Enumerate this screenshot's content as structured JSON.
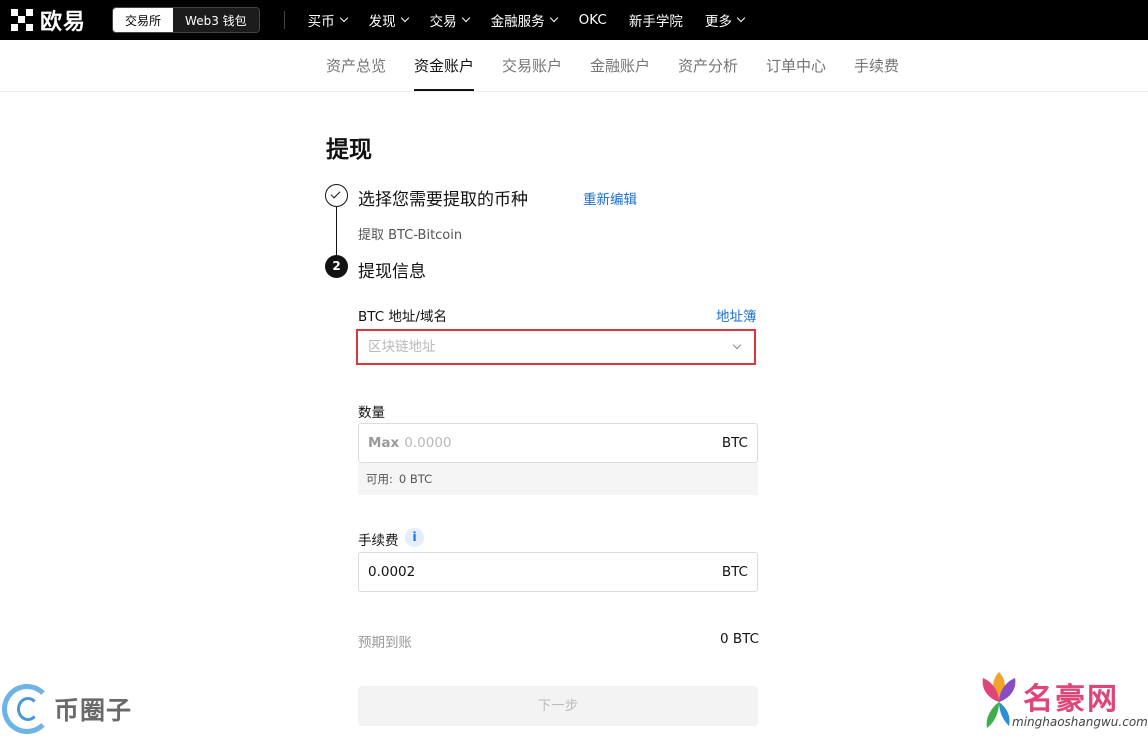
{
  "brand": {
    "name": "欧易"
  },
  "switcher": {
    "exchange": "交易所",
    "web3": "Web3 钱包"
  },
  "topnav": [
    {
      "label": "买币",
      "has_dropdown": true
    },
    {
      "label": "发现",
      "has_dropdown": true
    },
    {
      "label": "交易",
      "has_dropdown": true
    },
    {
      "label": "金融服务",
      "has_dropdown": true
    },
    {
      "label": "OKC",
      "has_dropdown": false
    },
    {
      "label": "新手学院",
      "has_dropdown": false
    },
    {
      "label": "更多",
      "has_dropdown": true
    }
  ],
  "subnav": {
    "tabs": [
      "资产总览",
      "资金账户",
      "交易账户",
      "金融账户",
      "资产分析",
      "订单中心",
      "手续费"
    ],
    "active": "资金账户"
  },
  "page": {
    "title": "提现"
  },
  "step1": {
    "title": "选择您需要提取的币种",
    "reedit": "重新编辑",
    "subtitle": "提取 BTC-Bitcoin"
  },
  "step2": {
    "number": "2",
    "title": "提现信息"
  },
  "address": {
    "label": "BTC 地址/域名",
    "address_book": "地址簿",
    "placeholder": "区块链地址"
  },
  "quantity": {
    "label": "数量",
    "max": "Max",
    "placeholder": "0.0000",
    "unit": "BTC",
    "available_label": "可用:",
    "available_value": "0 BTC"
  },
  "fee": {
    "label": "手续费",
    "info_icon": "i",
    "value": "0.0002",
    "unit": "BTC"
  },
  "expected": {
    "label": "预期到账",
    "value": "0 BTC"
  },
  "next_button": "下一步",
  "watermarks": {
    "left_text": "币圈子",
    "right_title": "名豪网",
    "right_url": "minghaoshangwu.com"
  },
  "colors": {
    "accent_link": "#1a6fd6",
    "error_border": "#d9363e",
    "topbar_bg": "#000000"
  }
}
